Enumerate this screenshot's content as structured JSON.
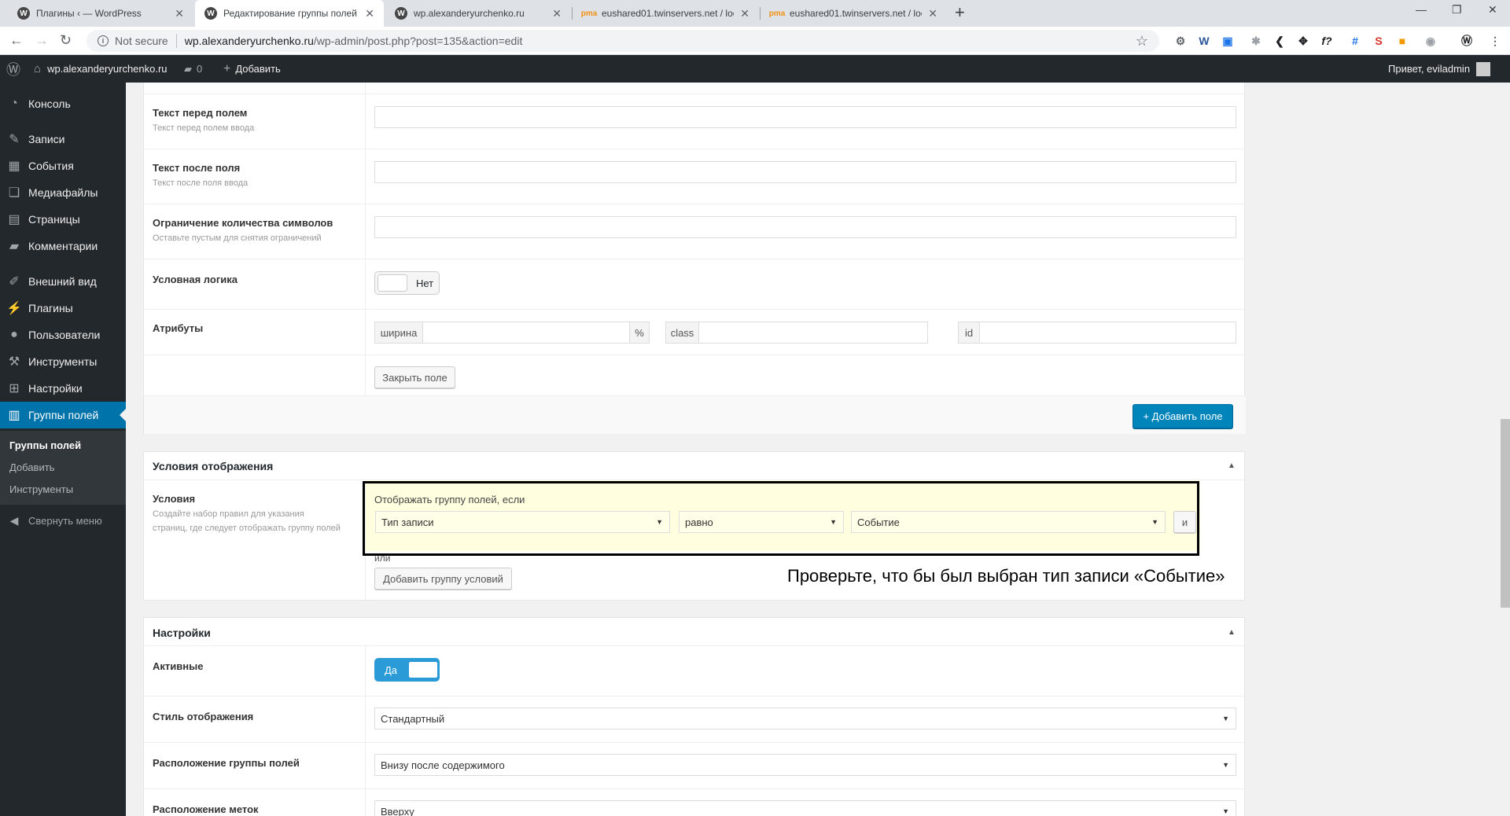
{
  "browser": {
    "tabs": [
      {
        "title": "Плагины ‹ — WordPress",
        "icon": "wordpress-icon"
      },
      {
        "title": "Редактирование группы полей",
        "icon": "wordpress-icon"
      },
      {
        "title": "wp.alexanderyurchenko.ru",
        "icon": "wordpress-icon"
      },
      {
        "title": "eushared01.twinservers.net / loc",
        "icon": "phpmyadmin-icon"
      },
      {
        "title": "eushared01.twinservers.net / loc",
        "icon": "phpmyadmin-icon"
      }
    ],
    "not_secure": "Not secure",
    "url_host": "wp.alexanderyurchenko.ru",
    "url_path": "/wp-admin/post.php?post=135&action=edit"
  },
  "adminbar": {
    "site_name": "wp.alexanderyurchenko.ru",
    "comments_count": "0",
    "add_new": "Добавить",
    "greeting": "Привет, eviladmin"
  },
  "sidebar": {
    "items": [
      {
        "label": "Консоль",
        "icon": "dashboard-icon"
      },
      {
        "label": "Записи",
        "icon": "pin-icon"
      },
      {
        "label": "События",
        "icon": "calendar-icon"
      },
      {
        "label": "Медиафайлы",
        "icon": "media-icon"
      },
      {
        "label": "Страницы",
        "icon": "pages-icon"
      },
      {
        "label": "Комментарии",
        "icon": "comments-icon"
      },
      {
        "label": "Внешний вид",
        "icon": "brush-icon"
      },
      {
        "label": "Плагины",
        "icon": "plugin-icon"
      },
      {
        "label": "Пользователи",
        "icon": "users-icon"
      },
      {
        "label": "Инструменты",
        "icon": "wrench-icon"
      },
      {
        "label": "Настройки",
        "icon": "settings-icon"
      },
      {
        "label": "Группы полей",
        "icon": "field-groups-icon"
      }
    ],
    "submenu": [
      "Группы полей",
      "Добавить",
      "Инструменты"
    ],
    "collapse": "Свернуть меню"
  },
  "field_settings": {
    "rows": [
      {
        "label": "Текст перед полем",
        "desc": "Текст перед полем ввода"
      },
      {
        "label": "Текст после поля",
        "desc": "Текст после поля ввода"
      },
      {
        "label": "Ограничение количества символов",
        "desc": "Оставьте пустым для снятия ограничений"
      },
      {
        "label": "Условная логика",
        "toggle": "Нет"
      },
      {
        "label": "Атрибуты"
      }
    ],
    "attributes": {
      "width": "ширина",
      "percent": "%",
      "class": "class",
      "id": "id"
    },
    "close_field": "Закрыть поле",
    "add_field": "+ Добавить поле"
  },
  "location": {
    "title": "Условия отображения",
    "rules_label": "Условия",
    "rules_desc": "Создайте набор правил для указания страниц, где следует отображать группу полей",
    "group_title": "Отображать группу полей, если",
    "param": "Тип записи",
    "operator": "равно",
    "value": "Событие",
    "and_button": "и",
    "or_label": "или",
    "add_group": "Добавить группу условий"
  },
  "annotation": "Проверьте, что бы был выбран тип записи «Событие»",
  "settings": {
    "title": "Настройки",
    "active_label": "Активные",
    "active_toggle": "Да",
    "style_label": "Стиль отображения",
    "style_value": "Стандартный",
    "position_label": "Расположение группы полей",
    "position_value": "Внизу после содержимого",
    "label_placement_label": "Расположение меток",
    "label_placement_value": "Вверху"
  },
  "colors": {
    "accent": "#0073aa",
    "admin_bg": "#23282d",
    "rule_highlight": "#ffffe0",
    "switch_on": "#2a9bd7"
  }
}
